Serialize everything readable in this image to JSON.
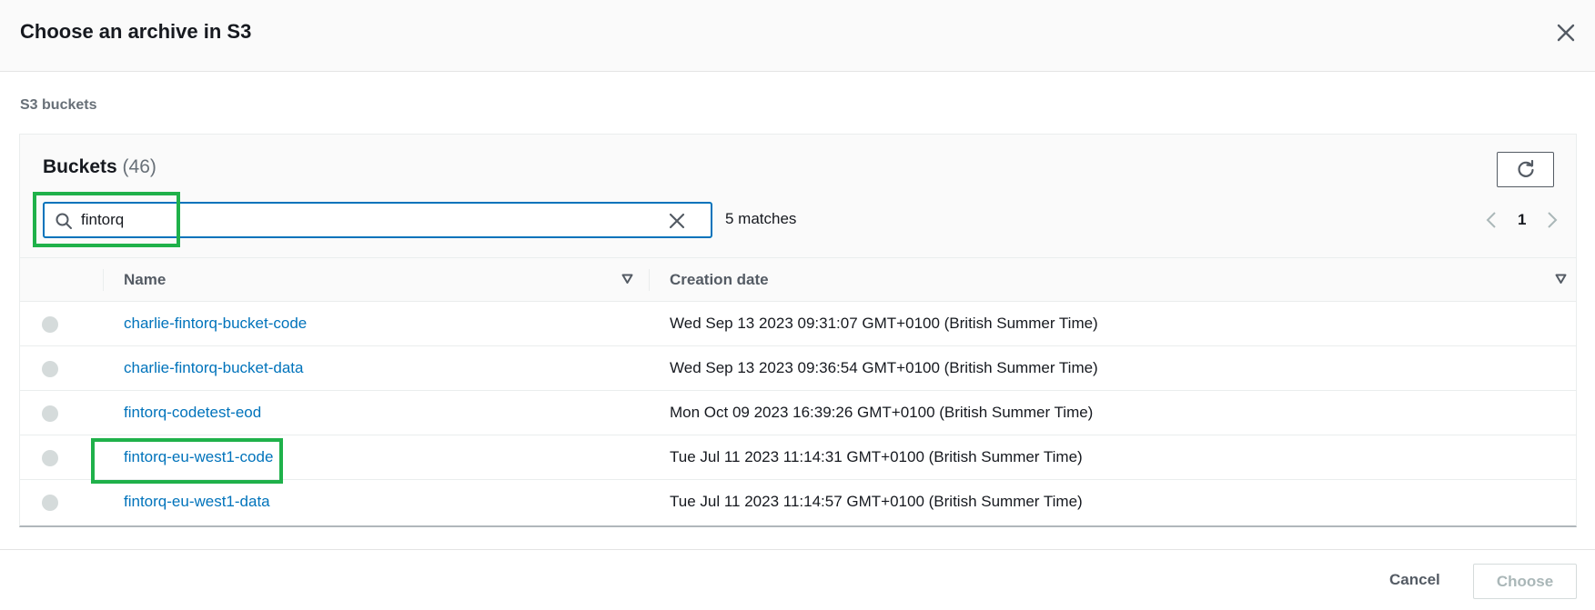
{
  "modal": {
    "title": "Choose an archive in S3",
    "close_icon": "close-icon"
  },
  "section_label": "S3 buckets",
  "buckets": {
    "title": "Buckets",
    "count": "(46)",
    "refresh_icon": "refresh-icon",
    "search": {
      "value": "fintorq",
      "placeholder": "Find buckets",
      "search_icon": "search-icon",
      "clear_icon": "clear-icon"
    },
    "matches_text": "5 matches",
    "pagination": {
      "current_page": "1",
      "prev_icon": "chevron-left-icon",
      "next_icon": "chevron-right-icon"
    },
    "columns": [
      {
        "label": "Name"
      },
      {
        "label": "Creation date"
      }
    ],
    "rows": [
      {
        "name": "charlie-fintorq-bucket-code",
        "created": "Wed Sep 13 2023 09:31:07 GMT+0100 (British Summer Time)"
      },
      {
        "name": "charlie-fintorq-bucket-data",
        "created": "Wed Sep 13 2023 09:36:54 GMT+0100 (British Summer Time)"
      },
      {
        "name": "fintorq-codetest-eod",
        "created": "Mon Oct 09 2023 16:39:26 GMT+0100 (British Summer Time)"
      },
      {
        "name": "fintorq-eu-west1-code",
        "created": "Tue Jul 11 2023 11:14:31 GMT+0100 (British Summer Time)"
      },
      {
        "name": "fintorq-eu-west1-data",
        "created": "Tue Jul 11 2023 11:14:57 GMT+0100 (British Summer Time)"
      }
    ]
  },
  "footer": {
    "cancel_label": "Cancel",
    "choose_label": "Choose"
  },
  "colors": {
    "link": "#0073bb",
    "highlight": "#1fb14a",
    "focus_border": "#0073bb"
  }
}
